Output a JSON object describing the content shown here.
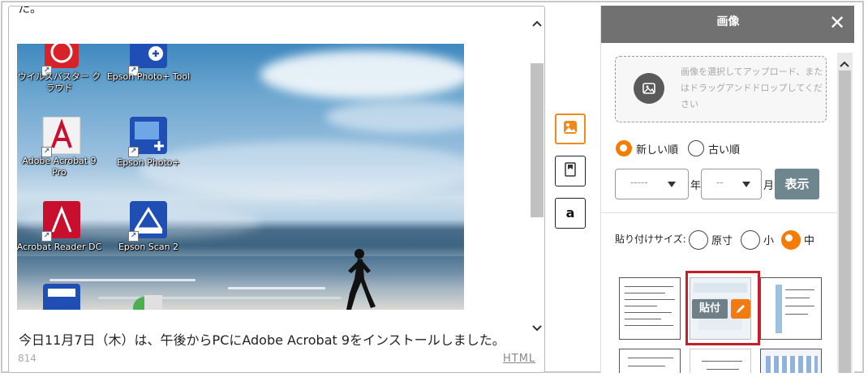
{
  "editor": {
    "cut_text": "た。",
    "body_text": "今日11月7日（木）は、午後からPCにAdobe Acrobat 9をインストールしました。",
    "char_count": "814",
    "html_link": "HTML",
    "desktop_icons": [
      {
        "label": "ウイルスバスター クラウド",
        "icon": "virus-buster-icon"
      },
      {
        "label": "Epson Photo+ Tool",
        "icon": "epson-photo-tool-icon"
      },
      {
        "label": "Adobe Acrobat 9 Pro",
        "icon": "adobe-acrobat-icon"
      },
      {
        "label": "Epson Photo+",
        "icon": "epson-photo-icon"
      },
      {
        "label": "Acrobat Reader DC",
        "icon": "acrobat-reader-icon"
      },
      {
        "label": "Epson Scan 2",
        "icon": "epson-scan-icon"
      }
    ]
  },
  "tools": [
    {
      "name": "image-tool",
      "active": true
    },
    {
      "name": "bookmark-tool",
      "active": false
    },
    {
      "name": "amazon-tool",
      "active": false,
      "glyph": "a"
    }
  ],
  "panel": {
    "title": "画像",
    "close": "✕",
    "upload_text": "画像を選択してアップロード、またはドラッグアンドドロップしてください",
    "sort": {
      "newest": "新しい順",
      "oldest": "古い順",
      "selected": "newest"
    },
    "year_select": {
      "value": "-----",
      "suffix": "年"
    },
    "month_select": {
      "value": "--",
      "suffix": "月"
    },
    "show_button": "表示",
    "paste_size": {
      "label": "貼り付けサイズ:",
      "options": [
        "原寸",
        "小",
        "中"
      ],
      "selected": "中"
    },
    "paste_button": "貼付"
  },
  "colors": {
    "accent": "#f57c00",
    "header": "#717171",
    "selected_border": "#c81e2b"
  }
}
